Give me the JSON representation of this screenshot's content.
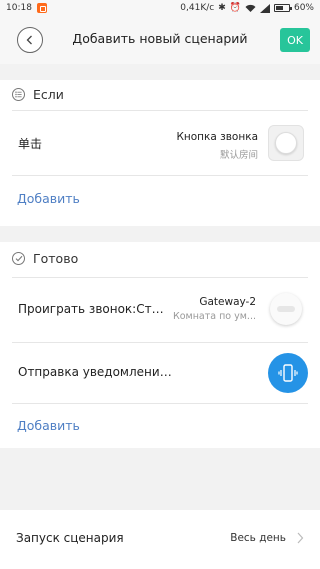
{
  "status_bar": {
    "time": "10:18",
    "net_speed": "0,41K/c",
    "battery": "60%",
    "battery_level": 0.6,
    "icons": [
      "mi-notification-icon",
      "bluetooth-icon",
      "alarm-icon",
      "wifi-icon",
      "signal-icon",
      "battery-icon"
    ]
  },
  "header": {
    "title": "Добавить новый сценарий",
    "ok_label": "OK"
  },
  "if_section": {
    "title": "Если",
    "condition": {
      "label": "单击",
      "device_name": "Кнопка звонка",
      "device_room": "默认房间"
    },
    "add_label": "Добавить"
  },
  "then_section": {
    "title": "Готово",
    "actions": [
      {
        "label": "Проиграть звонок:Стук,...",
        "device_name": "Gateway-2",
        "device_room": "Комната по ум..."
      },
      {
        "label": "Отправка уведомлений..."
      }
    ],
    "add_label": "Добавить"
  },
  "launch": {
    "label": "Запуск сценария",
    "value": "Весь день"
  },
  "colors": {
    "ok_button": "#27c59a",
    "link": "#4f7fc4",
    "notify_icon": "#2593e6"
  }
}
